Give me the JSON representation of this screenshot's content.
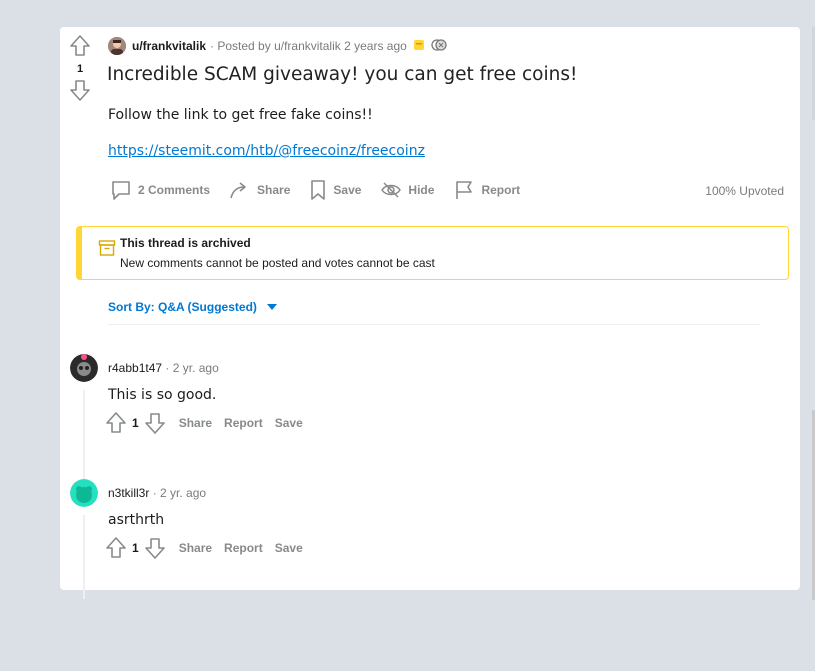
{
  "post": {
    "username": "u/frankvitalik",
    "posted_by": "· Posted by u/frankvitalik 2 years ago",
    "score": "1",
    "title": "Incredible SCAM giveaway! you can get free coins!",
    "body": "Follow the link to get free fake coins!!",
    "link": "https://steemit.com/htb/@freecoinz/freecoinz",
    "actions": {
      "comments": "2 Comments",
      "share": "Share",
      "save": "Save",
      "hide": "Hide",
      "report": "Report"
    },
    "upvoted": "100% Upvoted"
  },
  "archived": {
    "title": "This thread is archived",
    "subtitle": "New comments cannot be posted and votes cannot be cast"
  },
  "sort": {
    "label": "Sort By: Q&A (Suggested)"
  },
  "comments": [
    {
      "user": "r4abb1t47",
      "time": "· 2 yr. ago",
      "text": "This is so good.",
      "score": "1",
      "share": "Share",
      "report": "Report",
      "save": "Save"
    },
    {
      "user": "n3tkill3r",
      "time": "· 2 yr. ago",
      "text": "asrthrth",
      "score": "1",
      "share": "Share",
      "report": "Report",
      "save": "Save"
    }
  ],
  "colors": {
    "accent": "#0079d3",
    "archived_border": "#ffd635",
    "background": "#dae0e6"
  }
}
